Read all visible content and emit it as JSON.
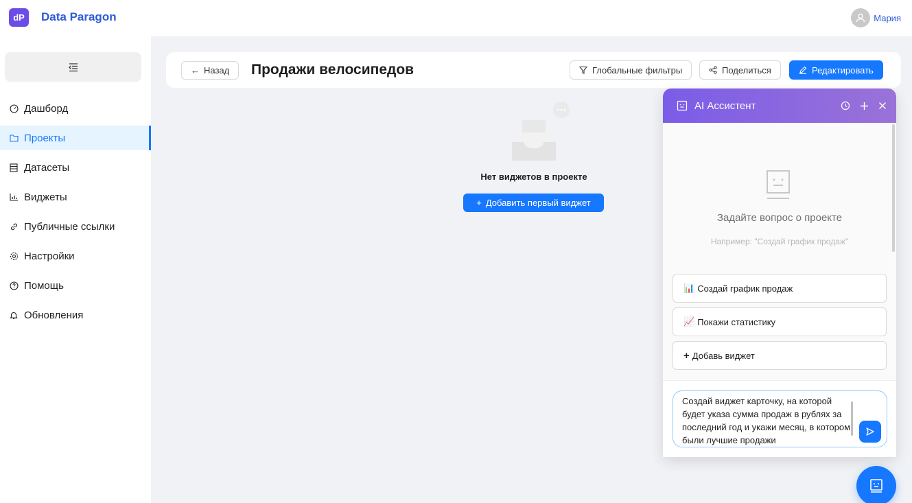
{
  "app": {
    "logo": "dP",
    "brand": "Data Paragon"
  },
  "user": {
    "name": "Мария",
    "icon": "user-icon"
  },
  "sidebar": {
    "collapse_icon": "menu-fold-icon",
    "items": [
      {
        "label": "Дашборд",
        "icon": "dashboard-icon"
      },
      {
        "label": "Проекты",
        "icon": "folder-icon",
        "active": true
      },
      {
        "label": "Датасеты",
        "icon": "dataset-icon"
      },
      {
        "label": "Виджеты",
        "icon": "chart-icon"
      },
      {
        "label": "Публичные ссылки",
        "icon": "link-icon"
      },
      {
        "label": "Настройки",
        "icon": "settings-icon"
      },
      {
        "label": "Помощь",
        "icon": "help-icon"
      },
      {
        "label": "Обновления",
        "icon": "bell-icon"
      }
    ]
  },
  "header": {
    "back_label": "Назад",
    "title": "Продажи велосипедов",
    "filters_label": "Глобальные фильтры",
    "share_label": "Поделиться",
    "edit_label": "Редактировать"
  },
  "empty_state": {
    "text": "Нет виджетов в проекте",
    "add_label": "Добавить первый виджет"
  },
  "ai": {
    "title": "AI Ассистент",
    "question": "Задайте вопрос о проекте",
    "example": "Например: \"Создай график продаж\"",
    "suggestions": [
      {
        "emoji": "📊",
        "label": "Создай график продаж"
      },
      {
        "emoji": "📈",
        "label": "Покажи статистику"
      },
      {
        "emoji": "+",
        "label": "Добавь виджет"
      }
    ],
    "input_value": "Создай виджет карточку, на которой будет указа сумма продаж в рублях за последний год и укажи месяц, в котором были лучшие продажи"
  },
  "colors": {
    "primary": "#1677ff",
    "brand": "#2d5bd8",
    "logo": "#6b4ce6",
    "ai_header": "#7b5ce8"
  }
}
